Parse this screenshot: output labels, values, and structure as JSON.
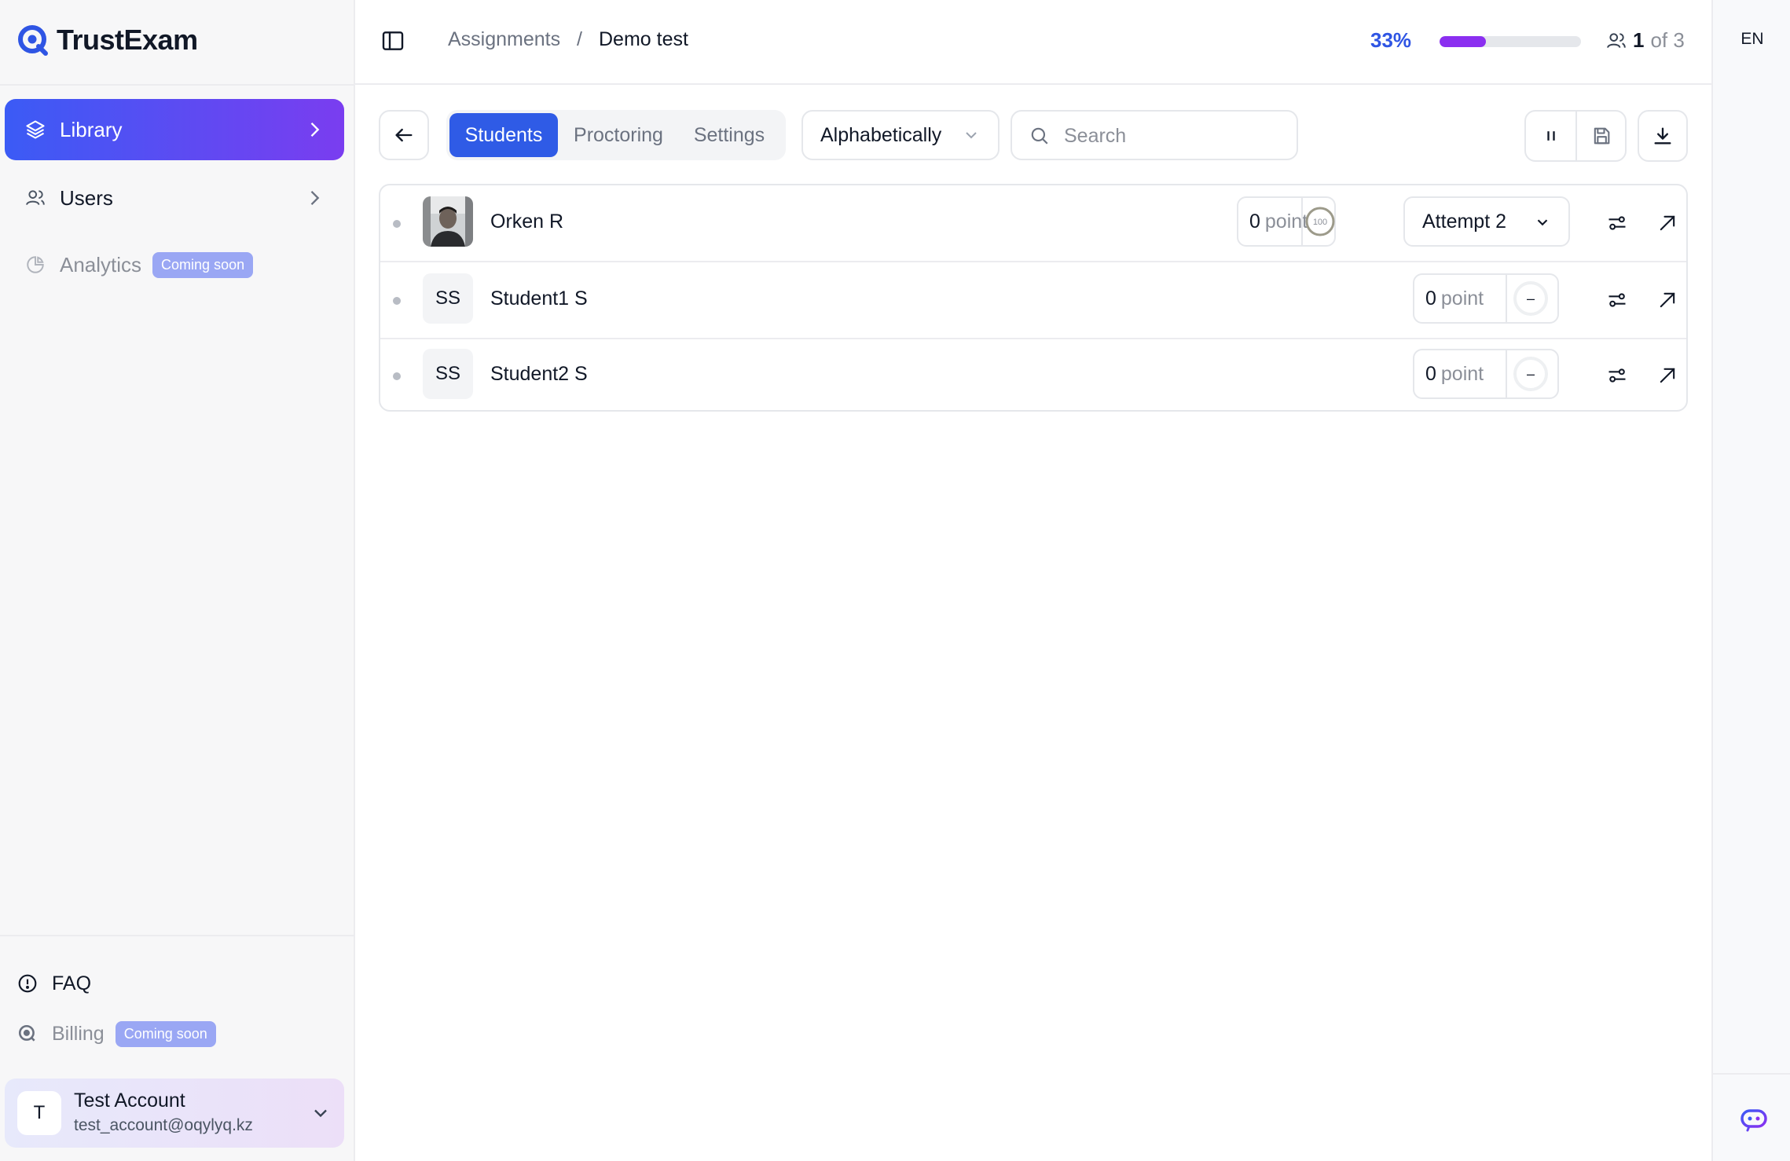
{
  "brand": {
    "name": "TrustExam",
    "icon": "trustexam-logo-icon",
    "color": "#2f55e4"
  },
  "sidebar": {
    "items": [
      {
        "label": "Library",
        "icon": "layers-icon",
        "active": true
      },
      {
        "label": "Users",
        "icon": "users-icon",
        "active": false
      },
      {
        "label": "Analytics",
        "icon": "pie-chart-icon",
        "badge": "Coming soon",
        "disabled": true
      }
    ],
    "footer": [
      {
        "label": "FAQ",
        "icon": "info-circle-icon"
      },
      {
        "label": "Billing",
        "icon": "billing-icon",
        "badge": "Coming soon",
        "disabled": true
      }
    ],
    "account": {
      "initial": "T",
      "name": "Test Account",
      "email": "test_account@oqylyq.kz"
    }
  },
  "header": {
    "breadcrumb": [
      "Assignments",
      "Demo test"
    ],
    "breadcrumb_separator": "/",
    "progress_label": "33%",
    "progress_fraction": 0.33,
    "users_current": "1",
    "users_of": "of 3"
  },
  "rail": {
    "language": "EN"
  },
  "toolbar": {
    "tabs": [
      {
        "label": "Students",
        "active": true
      },
      {
        "label": "Proctoring",
        "active": false
      },
      {
        "label": "Settings",
        "active": false
      }
    ],
    "sort_value": "Alphabetically",
    "search_placeholder": "Search",
    "search_value": ""
  },
  "students": [
    {
      "name": "Orken R",
      "avatar": "photo",
      "score": "0",
      "score_unit": "point",
      "ring_label": "100",
      "attempt": "Attempt 2"
    },
    {
      "name": "Student1 S",
      "avatar": "SS",
      "score": "0",
      "score_unit": "point",
      "ring_label": "–"
    },
    {
      "name": "Student2 S",
      "avatar": "SS",
      "score": "0",
      "score_unit": "point",
      "ring_label": "–"
    }
  ],
  "colors": {
    "accent": "#2f55e4",
    "gradient_start": "#3b5bf5",
    "gradient_end": "#7a3df0",
    "progress": "#8b2ff0"
  }
}
